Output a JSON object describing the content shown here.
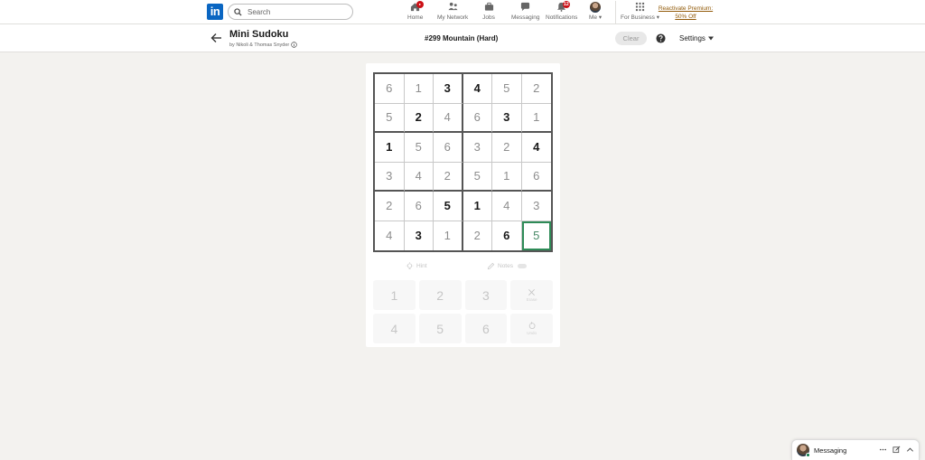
{
  "nav": {
    "logo": "in",
    "search_placeholder": "Search",
    "items": [
      {
        "label": "Home",
        "badge": "●"
      },
      {
        "label": "My Network"
      },
      {
        "label": "Jobs"
      },
      {
        "label": "Messaging"
      },
      {
        "label": "Notifications",
        "badge": "12"
      },
      {
        "label": "Me ▾"
      },
      {
        "label": "For Business ▾"
      }
    ],
    "premium_line1": "Reactivate Premium:",
    "premium_line2": "50% Off"
  },
  "game": {
    "title": "Mini Sudoku",
    "author": "by Nikoli & Thomas Snyder",
    "puzzle": "#299 Mountain (Hard)",
    "clear_label": "Clear",
    "settings_label": "Settings"
  },
  "grid": {
    "cells": [
      [
        "6",
        "1",
        "3",
        "4",
        "5",
        "2"
      ],
      [
        "5",
        "2",
        "4",
        "6",
        "3",
        "1"
      ],
      [
        "1",
        "5",
        "6",
        "3",
        "2",
        "4"
      ],
      [
        "3",
        "4",
        "2",
        "5",
        "1",
        "6"
      ],
      [
        "2",
        "6",
        "5",
        "1",
        "4",
        "3"
      ],
      [
        "4",
        "3",
        "1",
        "2",
        "6",
        "5"
      ]
    ],
    "given": [
      [
        false,
        false,
        true,
        true,
        false,
        false
      ],
      [
        false,
        true,
        false,
        false,
        true,
        false
      ],
      [
        true,
        false,
        false,
        false,
        false,
        true
      ],
      [
        false,
        false,
        false,
        false,
        false,
        false
      ],
      [
        false,
        false,
        true,
        true,
        false,
        false
      ],
      [
        false,
        true,
        false,
        false,
        true,
        false
      ]
    ],
    "selected_row": 5,
    "selected_col": 5
  },
  "tools": {
    "hint_label": "Hint",
    "notes_label": "Notes"
  },
  "keypad": {
    "keys": [
      "1",
      "2",
      "3",
      "4",
      "5",
      "6"
    ],
    "erase_label": "Erase",
    "undo_label": "Undo"
  },
  "messaging": {
    "label": "Messaging"
  },
  "colors": {
    "brand": "#0a66c2",
    "selected_cell": "#2e8b57",
    "badge": "#cc1016",
    "premium": "#915907"
  }
}
